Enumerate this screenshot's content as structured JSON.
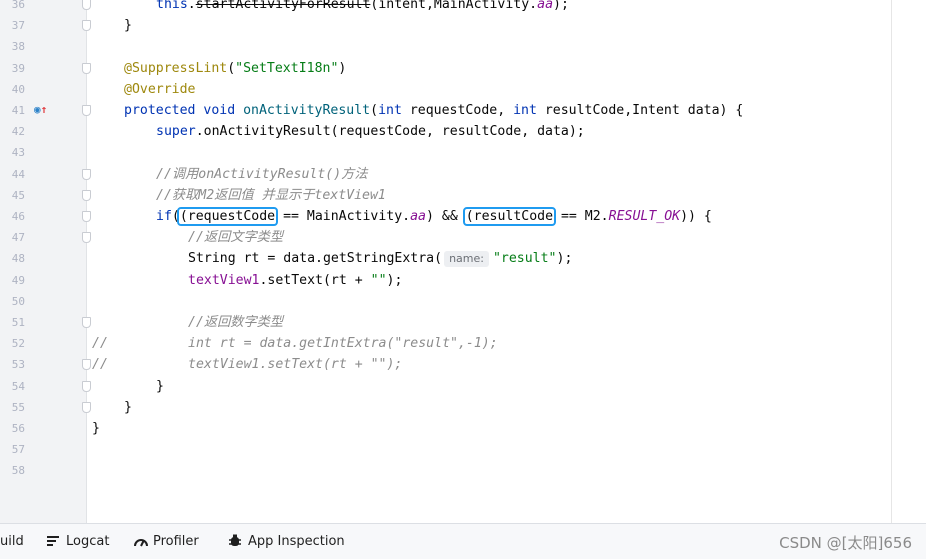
{
  "editor": {
    "lines": [
      {
        "n": "36",
        "indent": 1,
        "tokens": [
          [
            "kw",
            "this"
          ],
          [
            "",
            "."
          ],
          [
            "strike",
            "startActivityForResult"
          ],
          [
            "",
            "(intent,MainActivity."
          ],
          [
            "cst",
            "aa"
          ],
          [
            "",
            ");"
          ]
        ]
      },
      {
        "n": "37",
        "indent": 0,
        "tokens": [
          [
            "",
            "}"
          ]
        ]
      },
      {
        "n": "38",
        "indent": 0,
        "tokens": []
      },
      {
        "n": "39",
        "indent": 0,
        "tokens": [
          [
            "ann",
            "@SuppressLint"
          ],
          [
            "",
            "("
          ],
          [
            "str",
            "\"SetTextI18n\""
          ],
          [
            "",
            ")"
          ]
        ]
      },
      {
        "n": "40",
        "indent": 0,
        "tokens": [
          [
            "ann",
            "@Override"
          ]
        ]
      },
      {
        "n": "41",
        "indent": 0,
        "tokens": [
          [
            "kw",
            "protected void "
          ],
          [
            "fn",
            "onActivityResult"
          ],
          [
            "",
            "("
          ],
          [
            "kw",
            "int "
          ],
          [
            "",
            "requestCode, "
          ],
          [
            "kw",
            "int "
          ],
          [
            "",
            "resultCode,Intent data) {"
          ]
        ]
      },
      {
        "n": "42",
        "indent": 1,
        "tokens": [
          [
            "kw",
            "super"
          ],
          [
            "",
            ".onActivityResult(requestCode, resultCode, data);"
          ]
        ]
      },
      {
        "n": "43",
        "indent": 0,
        "tokens": []
      },
      {
        "n": "44",
        "indent": 1,
        "tokens": [
          [
            "cmt",
            "//调用onActivityResult()方法"
          ]
        ]
      },
      {
        "n": "45",
        "indent": 1,
        "tokens": [
          [
            "cmt",
            "//获取M2返回值 并显示于textView1"
          ]
        ]
      },
      {
        "n": "46",
        "indent": 1,
        "tokens": [
          [
            "kw",
            "if"
          ],
          [
            "",
            "("
          ],
          [
            "hl",
            "(requestCode"
          ],
          [
            "",
            " == MainActivity."
          ],
          [
            "cst",
            "aa"
          ],
          [
            "",
            ") && "
          ],
          [
            "hl",
            "(resultCode"
          ],
          [
            "",
            " == M2."
          ],
          [
            "cst",
            "RESULT_OK"
          ],
          [
            "",
            ")) {"
          ]
        ]
      },
      {
        "n": "47",
        "indent": 2,
        "tokens": [
          [
            "cmt",
            "//返回文字类型"
          ]
        ]
      },
      {
        "n": "48",
        "indent": 2,
        "tokens": [
          [
            "",
            "String rt = data.getStringExtra("
          ],
          [
            "hint",
            "name:"
          ],
          [
            "str",
            "\"result\""
          ],
          [
            "",
            ");"
          ]
        ]
      },
      {
        "n": "49",
        "indent": 2,
        "tokens": [
          [
            "fld",
            "textView1"
          ],
          [
            "",
            ".setText(rt + "
          ],
          [
            "str",
            "\"\""
          ],
          [
            "",
            ");"
          ]
        ]
      },
      {
        "n": "50",
        "indent": 0,
        "tokens": []
      },
      {
        "n": "51",
        "indent": 2,
        "tokens": [
          [
            "cmt",
            "//返回数字类型"
          ]
        ]
      },
      {
        "n": "52",
        "indent": 0,
        "prefix": "//",
        "tokens": [
          [
            "cmt",
            "int rt = data.getIntExtra(\"result\",-1);"
          ]
        ]
      },
      {
        "n": "53",
        "indent": 0,
        "prefix": "//",
        "tokens": [
          [
            "cmt",
            "textView1.setText(rt + \"\");"
          ]
        ]
      },
      {
        "n": "54",
        "indent": 1,
        "tokens": [
          [
            "",
            "}"
          ]
        ]
      },
      {
        "n": "55",
        "indent": 0,
        "tokens": [
          [
            "",
            "}"
          ]
        ]
      },
      {
        "n": "56",
        "indent": -1,
        "tokens": [
          [
            "",
            "}"
          ]
        ]
      },
      {
        "n": "57",
        "indent": 0,
        "tokens": []
      },
      {
        "n": "58",
        "indent": 0,
        "tokens": []
      }
    ],
    "fold_lines": [
      "36",
      "37",
      "39",
      "41",
      "44",
      "45",
      "46",
      "47",
      "51",
      "53",
      "54",
      "55"
    ],
    "override_marker_line": "41"
  },
  "bottom_bar": {
    "items": [
      {
        "label": "uild",
        "icon": "build-icon"
      },
      {
        "label": "Logcat",
        "icon": "logcat-icon"
      },
      {
        "label": "Profiler",
        "icon": "profiler-icon"
      },
      {
        "label": "App Inspection",
        "icon": "app-inspection-icon"
      }
    ],
    "watermark": "CSDN @[太阳]656"
  }
}
